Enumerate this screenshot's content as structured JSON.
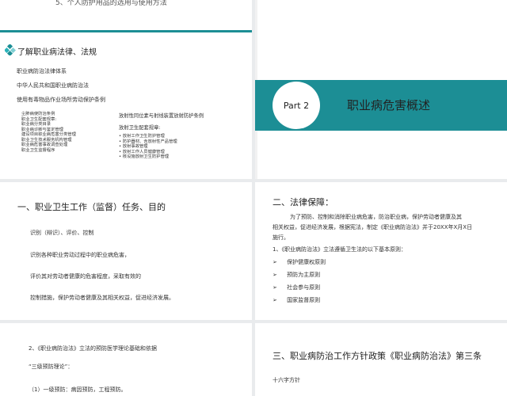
{
  "slide1": {
    "header": "5、个人防护用品的选用与使用方法",
    "title": "了解职业病法律、法规",
    "lines": [
      "职业病防治法律体系",
      "中华人民共和国职业病防治法",
      "使用有毒物品作业场所劳动保护条例"
    ],
    "left_list": [
      "尘肺病使防治条例",
      "职业卫生配套规章:",
      "职业病分类目录",
      "职业病诊断与鉴定管理",
      "建设项目职业病危害分类管理",
      "职业卫生技术服务机构管理",
      "职业病危害事故调查处理",
      "职业卫生监督程序"
    ],
    "right_title": "放射性同位素与射线装置放射防护条例",
    "right_sub": "放射卫生配套规章:",
    "right_list": [
      "• 放射工作卫生防护管理",
      "• 防护器材、含放射性产品管理",
      "• 放射事故管理",
      "• 放射工作人员健康管理",
      "• 核设施放射卫生防护管理"
    ]
  },
  "slide2": {
    "part_label": "Part 2",
    "title": "职业病危害概述"
  },
  "slide3": {
    "title": "一、职业卫生工作（监督）任务、目的",
    "lines": [
      "识别（辩识）、评价、控制",
      "识别各种职业劳动过程中的职业病危害，",
      "评价其对劳动者健康的危害程度，采取有效的",
      "控制措施，保护劳动者健康及其相关权益，促进经济发展。"
    ]
  },
  "slide4": {
    "title": "二、法律保障：",
    "para1": "为了预防、控制和消除职业病危害，防治职业病，保护劳动者健康及其",
    "para2": "相关权益，促进经济发展，根据宪法，制定《职业病防治法》并于20XX年X月X日",
    "para3": "施行。",
    "intro": "1、《职业病防治法》立法遵循卫生法的以下基本原则：",
    "bullet_glyph": "➢",
    "principles": [
      "保护健康权原则",
      "预防为主原则",
      "社会参与原则",
      "国家监督原则"
    ]
  },
  "slide5": {
    "line1": "2、《职业病防治法》立法的预防医学理论基础和依据",
    "line2": "“三级预防理论”：",
    "line3": "（1）一级预防：病因预防，工程预防。"
  },
  "slide6": {
    "title": "三、职业病防治工作方针政策《职业病防治法》第三条",
    "line1": "十六字方针"
  },
  "colors": {
    "accent": "#1c8e95",
    "background": "#e9ebed"
  }
}
